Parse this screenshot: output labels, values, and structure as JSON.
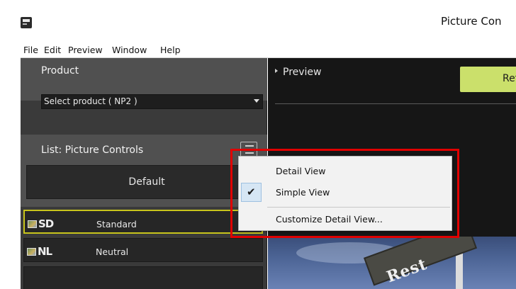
{
  "window": {
    "title": "Picture Con",
    "icon": "app-icon"
  },
  "menubar": {
    "items": [
      "File",
      "Edit",
      "Preview",
      "Window",
      "Help"
    ]
  },
  "sidebar": {
    "product": {
      "label": "Product",
      "selected": "Select product ( NP2 )"
    },
    "list": {
      "label": "List: Picture Controls",
      "view_toggle_icon": "list-view-icon",
      "default_label": "Default",
      "items": [
        {
          "code": "SD",
          "name": "Standard",
          "selected": true
        },
        {
          "code": "NL",
          "name": "Neutral",
          "selected": false
        }
      ]
    }
  },
  "preview": {
    "label": "Preview",
    "button_label": "Ref",
    "image_text": "Rest"
  },
  "context_menu": {
    "items": [
      {
        "label": "Detail View",
        "checked": false
      },
      {
        "label": "Simple View",
        "checked": true
      },
      {
        "label": "Customize Detail View...",
        "checked": false
      }
    ],
    "check_glyph": "✔"
  },
  "colors": {
    "accent_button": "#cbe06b",
    "selected_outline": "#c8c41c",
    "highlight": "#e10000"
  }
}
